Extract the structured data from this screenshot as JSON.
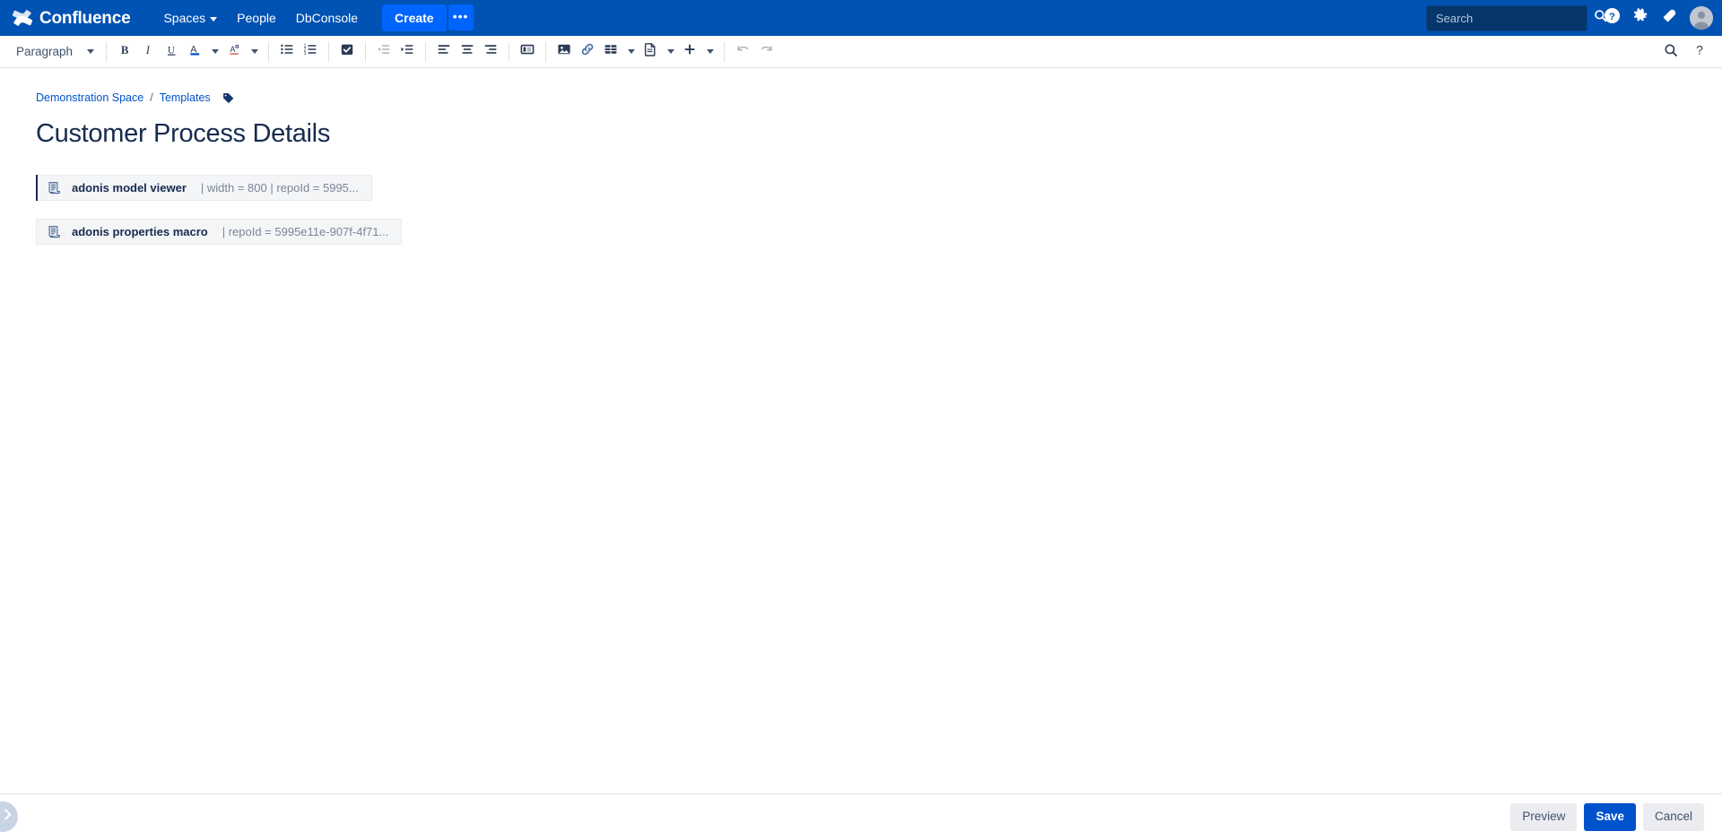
{
  "header": {
    "brand_name": "Confluence",
    "brand_logo_icon": "confluence-logo-icon",
    "nav_items": [
      {
        "label": "Spaces",
        "has_caret": true
      },
      {
        "label": "People",
        "has_caret": false
      },
      {
        "label": "DbConsole",
        "has_caret": false
      }
    ],
    "create_label": "Create",
    "create_more_label": "•••",
    "search_placeholder": "Search",
    "search_value": "",
    "search_icon": "search-icon",
    "help_icon": "help-circle-icon",
    "settings_icon": "gear-icon",
    "notifications_icon": "notification-bell-icon",
    "avatar_icon": "user-avatar-icon",
    "bg_color": "#0052B3",
    "create_color": "#0065FF"
  },
  "toolbar": {
    "style_select_label": "Paragraph",
    "buttons": [
      {
        "name": "bold-button",
        "icon": "bold-icon",
        "label": "Bold",
        "disabled": false
      },
      {
        "name": "italic-button",
        "icon": "italic-icon",
        "label": "Italic",
        "disabled": false
      },
      {
        "name": "underline-button",
        "icon": "underline-icon",
        "label": "Underline",
        "disabled": false
      },
      {
        "name": "text-color-button",
        "icon": "text-color-icon",
        "label": "Text color",
        "disabled": false
      },
      {
        "name": "text-highlight-button",
        "icon": "highlighter-icon",
        "label": "Highlight",
        "disabled": false
      },
      {
        "name": "bullet-list-button",
        "icon": "bullet-list-icon",
        "label": "Bulleted list",
        "disabled": false
      },
      {
        "name": "numbered-list-button",
        "icon": "numbered-list-icon",
        "label": "Numbered list",
        "disabled": false
      },
      {
        "name": "task-list-button",
        "icon": "checkbox-icon",
        "label": "Task list",
        "disabled": false
      },
      {
        "name": "outdent-button",
        "icon": "outdent-icon",
        "label": "Outdent",
        "disabled": true
      },
      {
        "name": "indent-button",
        "icon": "indent-icon",
        "label": "Indent",
        "disabled": false
      },
      {
        "name": "align-left-button",
        "icon": "align-left-icon",
        "label": "Align left",
        "disabled": false
      },
      {
        "name": "align-center-button",
        "icon": "align-center-icon",
        "label": "Align center",
        "disabled": false
      },
      {
        "name": "align-right-button",
        "icon": "align-right-icon",
        "label": "Align right",
        "disabled": false
      },
      {
        "name": "page-layout-button",
        "icon": "page-layout-icon",
        "label": "Page layout",
        "disabled": false
      },
      {
        "name": "insert-image-button",
        "icon": "image-icon",
        "label": "Insert image",
        "disabled": false
      },
      {
        "name": "insert-link-button",
        "icon": "link-icon",
        "label": "Insert link",
        "disabled": false
      },
      {
        "name": "insert-table-button",
        "icon": "table-icon",
        "label": "Insert table",
        "disabled": false
      },
      {
        "name": "insert-template-button",
        "icon": "page-icon",
        "label": "Templates",
        "disabled": false
      },
      {
        "name": "insert-more-button",
        "icon": "plus-icon",
        "label": "Insert more",
        "disabled": false
      },
      {
        "name": "undo-button",
        "icon": "undo-icon",
        "label": "Undo",
        "disabled": true
      },
      {
        "name": "redo-button",
        "icon": "redo-icon",
        "label": "Redo",
        "disabled": true
      }
    ],
    "find_replace_icon": "search-icon",
    "help_icon": "question-mark-icon"
  },
  "breadcrumb": {
    "items": [
      {
        "label": "Demonstration Space"
      },
      {
        "label": "Templates"
      }
    ],
    "separator": "/",
    "tag_icon": "label-tag-icon"
  },
  "document": {
    "title": "Customer Process Details",
    "macros": [
      {
        "icon": "macro-placeholder-icon",
        "name": "adonis model viewer",
        "params": "| width = 800 | repoId = 5995...",
        "selected": true
      },
      {
        "icon": "macro-placeholder-icon",
        "name": "adonis properties macro",
        "params": "| repoId = 5995e11e-907f-4f71...",
        "selected": false
      }
    ]
  },
  "footer": {
    "preview_label": "Preview",
    "save_label": "Save",
    "cancel_label": "Cancel",
    "sidebar_toggle_icon": "chevron-right-icon"
  }
}
